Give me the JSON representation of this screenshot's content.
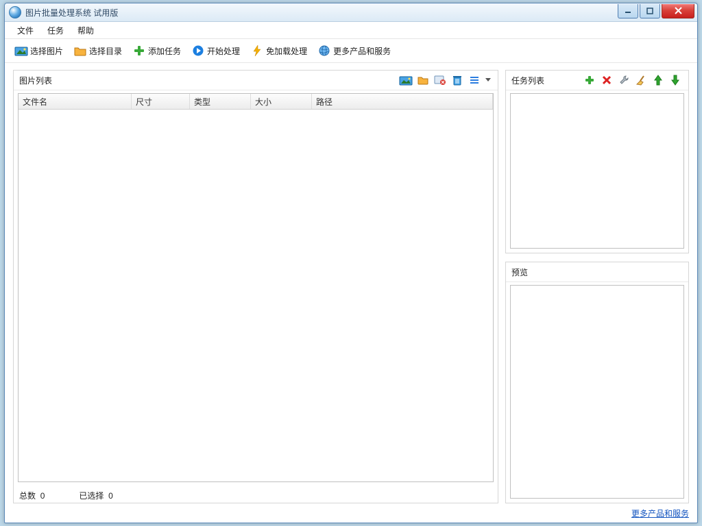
{
  "window": {
    "title": "图片批量处理系统 试用版"
  },
  "menu": {
    "file": "文件",
    "task": "任务",
    "help": "帮助"
  },
  "toolbar": {
    "select_images": "选择图片",
    "select_folder": "选择目录",
    "add_task": "添加任务",
    "start_process": "开始处理",
    "no_load_process": "免加载处理",
    "more_products": "更多产品和服务"
  },
  "image_list": {
    "title": "图片列表",
    "columns": {
      "name": "文件名",
      "size_dims": "尺寸",
      "type": "类型",
      "size_bytes": "大小",
      "path": "路径"
    },
    "rows": []
  },
  "status": {
    "total_label": "总数",
    "total_value": "0",
    "selected_label": "已选择",
    "selected_value": "0"
  },
  "task_list": {
    "title": "任务列表",
    "items": []
  },
  "preview": {
    "title": "预览"
  },
  "footer": {
    "more_link": "更多产品和服务"
  }
}
